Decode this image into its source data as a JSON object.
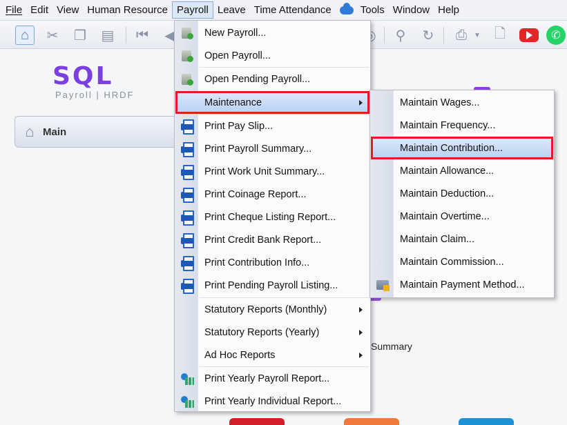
{
  "menubar": {
    "file": "File",
    "edit": "Edit",
    "view": "View",
    "human_resource": "Human Resource",
    "payroll": "Payroll",
    "leave": "Leave",
    "time_attendance": "Time Attendance",
    "tools": "Tools",
    "window": "Window",
    "help": "Help"
  },
  "logo": {
    "title": "SQL",
    "subtitle": "Payroll | HRDF"
  },
  "main_tab": {
    "label": "Main"
  },
  "background": {
    "summary_text": "Summary"
  },
  "payroll_menu": {
    "items": [
      {
        "label": "New Payroll...",
        "icon": "new-payroll-icon"
      },
      {
        "label": "Open Payroll...",
        "icon": "open-payroll-icon"
      },
      {
        "label": "Open Pending Payroll...",
        "icon": "pending-payroll-icon"
      },
      {
        "label": "Maintenance",
        "submenu": true
      },
      {
        "label": "Print Pay Slip...",
        "icon": "printer-icon"
      },
      {
        "label": "Print Payroll Summary...",
        "icon": "printer-icon"
      },
      {
        "label": "Print Work Unit Summary...",
        "icon": "printer-icon"
      },
      {
        "label": "Print Coinage Report...",
        "icon": "printer-icon"
      },
      {
        "label": "Print Cheque Listing Report...",
        "icon": "printer-icon"
      },
      {
        "label": "Print Credit Bank Report...",
        "icon": "printer-icon"
      },
      {
        "label": "Print Contribution Info...",
        "icon": "printer-icon"
      },
      {
        "label": "Print Pending Payroll Listing...",
        "icon": "printer-icon"
      },
      {
        "label": "Statutory Reports (Monthly)",
        "submenu": true
      },
      {
        "label": "Statutory Reports (Yearly)",
        "submenu": true
      },
      {
        "label": "Ad Hoc Reports",
        "submenu": true
      },
      {
        "label": "Print Yearly Payroll Report...",
        "icon": "yearly-report-icon"
      },
      {
        "label": "Print Yearly Individual Report...",
        "icon": "yearly-report-icon"
      }
    ]
  },
  "maintenance_menu": {
    "items": [
      {
        "label": "Maintain Wages..."
      },
      {
        "label": "Maintain Frequency..."
      },
      {
        "label": "Maintain Contribution..."
      },
      {
        "label": "Maintain Allowance..."
      },
      {
        "label": "Maintain Deduction..."
      },
      {
        "label": "Maintain Overtime..."
      },
      {
        "label": "Maintain Claim..."
      },
      {
        "label": "Maintain Commission..."
      },
      {
        "label": "Maintain Payment Method...",
        "icon": "payment-method-icon"
      }
    ]
  },
  "colors": {
    "highlight_outline": "#e31b23",
    "logo": "#7b3fe0",
    "menu_highlight": "#b8d0f3",
    "print_icon": "#2563c7"
  }
}
